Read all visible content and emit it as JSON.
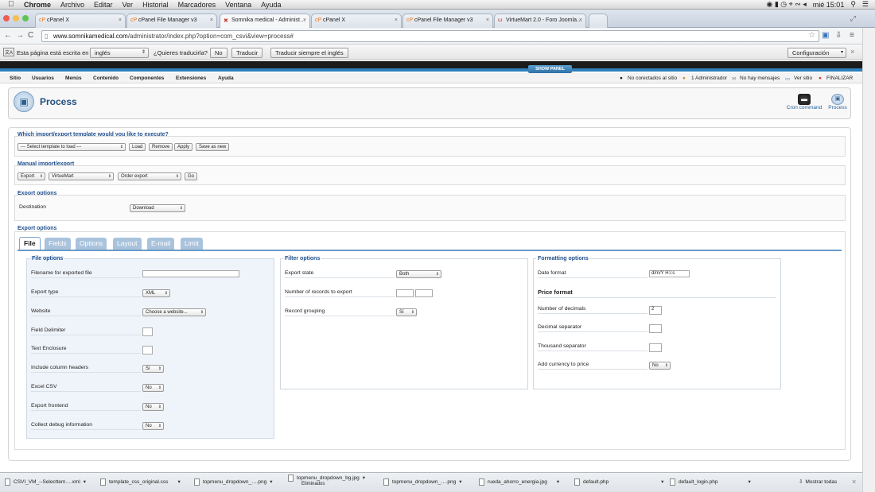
{
  "os_menubar": {
    "app": "Chrome",
    "items": [
      "Archivo",
      "Editar",
      "Ver",
      "Historial",
      "Marcadores",
      "Ventana",
      "Ayuda"
    ],
    "clock": "mié 15:01"
  },
  "browser": {
    "tabs": [
      {
        "label": "cPanel X",
        "active": false
      },
      {
        "label": "cPanel File Manager v3",
        "active": false
      },
      {
        "label": "Somnika medical - Administ…",
        "active": true
      },
      {
        "label": "cPanel X",
        "active": false
      },
      {
        "label": "cPanel File Manager v3",
        "active": false
      },
      {
        "label": "VirtueMart 2.0 - Foro Joomla…",
        "active": false
      }
    ],
    "url_domain": "www.somnikamedical.com",
    "url_path": "/administrator/index.php?option=com_csvi&view=process#"
  },
  "translate_bar": {
    "prefix": "Esta página está escrita en",
    "language": "inglés",
    "question": "¿Quieres traducirla?",
    "no_button": "No",
    "translate_button": "Traducir",
    "always_button": "Traducir siempre el inglés",
    "config_button": "Configuración"
  },
  "joomla": {
    "show_panel": "SHOW PANEL",
    "menu": [
      "Sitio",
      "Usuarios",
      "Menús",
      "Contenido",
      "Componentes",
      "Extensiones",
      "Ayuda"
    ],
    "status": {
      "uncorrected": "No corectados al sitio",
      "admins": "1 Administrador",
      "messages": "No hay mensajes",
      "view_site": "Ver sitio",
      "logout": "FINALIZAR"
    },
    "page_title": "Process",
    "toolbar": {
      "cron": "Cron command",
      "process": "Process"
    }
  },
  "template_section": {
    "title": "Which import/export template would you like to execute?",
    "select_value": "--- Select template to load ---",
    "buttons": [
      "Load",
      "Remove",
      "Apply",
      "Save as new"
    ]
  },
  "manual_section": {
    "title": "Manual import/export",
    "action": "Export",
    "component": "VirtueMart",
    "operation": "Order export",
    "go": "Go"
  },
  "export_options_1": {
    "title": "Export options",
    "destination_label": "Destination",
    "destination_value": "Download"
  },
  "export_options_2": {
    "title": "Export options",
    "tabs": [
      "File",
      "Fields",
      "Options",
      "Layout",
      "E-mail",
      "Limit"
    ],
    "active_tab": "File"
  },
  "file_options": {
    "title": "File options",
    "rows": [
      {
        "label": "Filename for exported file",
        "type": "input",
        "value": ""
      },
      {
        "label": "Export type",
        "type": "select",
        "value": "XML"
      },
      {
        "label": "Website",
        "type": "select",
        "value": "Choose a website..."
      },
      {
        "label": "Field Delimiter",
        "type": "small",
        "value": ""
      },
      {
        "label": "Text Enclosure",
        "type": "small",
        "value": ""
      },
      {
        "label": "Include column headers",
        "type": "select",
        "value": "Sí"
      },
      {
        "label": "Excel CSV",
        "type": "select",
        "value": "No"
      },
      {
        "label": "Export frontend",
        "type": "select",
        "value": "No"
      },
      {
        "label": "Collect debug information",
        "type": "select",
        "value": "No"
      }
    ]
  },
  "filter_options": {
    "title": "Filter options",
    "export_state_label": "Export state",
    "export_state_value": "Both",
    "records_label": "Number of records to export",
    "grouping_label": "Record grouping",
    "grouping_value": "Sí"
  },
  "formatting_options": {
    "title": "Formatting options",
    "date_format_label": "Date format",
    "date_format_value": "d/m/Y H:i:s",
    "price_format_heading": "Price format",
    "decimals_label": "Number of decimals",
    "decimals_value": "2",
    "decimal_sep_label": "Decimal separator",
    "thousand_sep_label": "Thousand separator",
    "currency_label": "Add currency to price",
    "currency_value": "No"
  },
  "downloads": {
    "items": [
      {
        "name": "CSVI_VM_--Selecttem….xml",
        "sub": ""
      },
      {
        "name": "template_css_original.css",
        "sub": ""
      },
      {
        "name": "topmenu_dropdown_….png",
        "sub": ""
      },
      {
        "name": "topmenu_dropdown_bg.jpg",
        "sub": "Eliminados"
      },
      {
        "name": "topmenu_dropdown_….png",
        "sub": ""
      },
      {
        "name": "rueda_ahorro_energia.jpg",
        "sub": ""
      },
      {
        "name": "default.php",
        "sub": ""
      },
      {
        "name": "default_login.php",
        "sub": ""
      }
    ],
    "show_all": "Mostrar todas"
  }
}
